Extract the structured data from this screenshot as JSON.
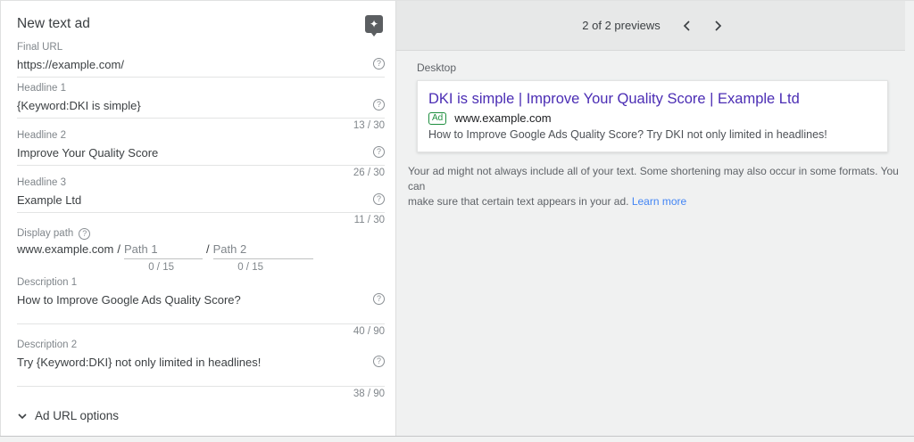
{
  "ad_editor": {
    "title": "New text ad",
    "fields": [
      {
        "label": "Final URL",
        "value": "https://example.com/",
        "counter": ""
      },
      {
        "label": "Headline 1",
        "value": "{Keyword:DKI is simple}",
        "counter": "13 / 30"
      },
      {
        "label": "Headline 2",
        "value": "Improve Your Quality Score",
        "counter": "26 / 30"
      },
      {
        "label": "Headline 3",
        "value": "Example Ltd",
        "counter": "11 / 30"
      }
    ],
    "display_path": {
      "label": "Display path",
      "base_url": "www.example.com",
      "separator1": "/",
      "separator2": "/",
      "path1_placeholder": "Path 1",
      "path2_placeholder": "Path 2",
      "path1_counter": "0 / 15",
      "path2_counter": "0 / 15"
    },
    "descriptions": [
      {
        "label": "Description 1",
        "value": "How to Improve Google Ads Quality Score?",
        "counter": "40 / 90"
      },
      {
        "label": "Description 2",
        "value": "Try {Keyword:DKI} not only limited in headlines!",
        "counter": "38 / 90"
      }
    ],
    "ad_url_options": "Ad URL options"
  },
  "preview": {
    "pager": "2 of 2 previews",
    "device": "Desktop",
    "ad": {
      "headline": "DKI is simple | Improve Your Quality Score | Example Ltd",
      "badge": "Ad",
      "display_url": "www.example.com",
      "description": "How to Improve Google Ads Quality Score? Try DKI not only limited in headlines!"
    },
    "disclaimer_line1": "Your ad might not always include all of your text. Some shortening may also occur in some formats. You can",
    "disclaimer_line2": "make sure that certain text appears in your ad.",
    "learn_more": "Learn more"
  },
  "colors": {
    "headline_link": "#4b2db4",
    "badge_green": "#1e8e3e",
    "link_blue": "#4285f4"
  }
}
